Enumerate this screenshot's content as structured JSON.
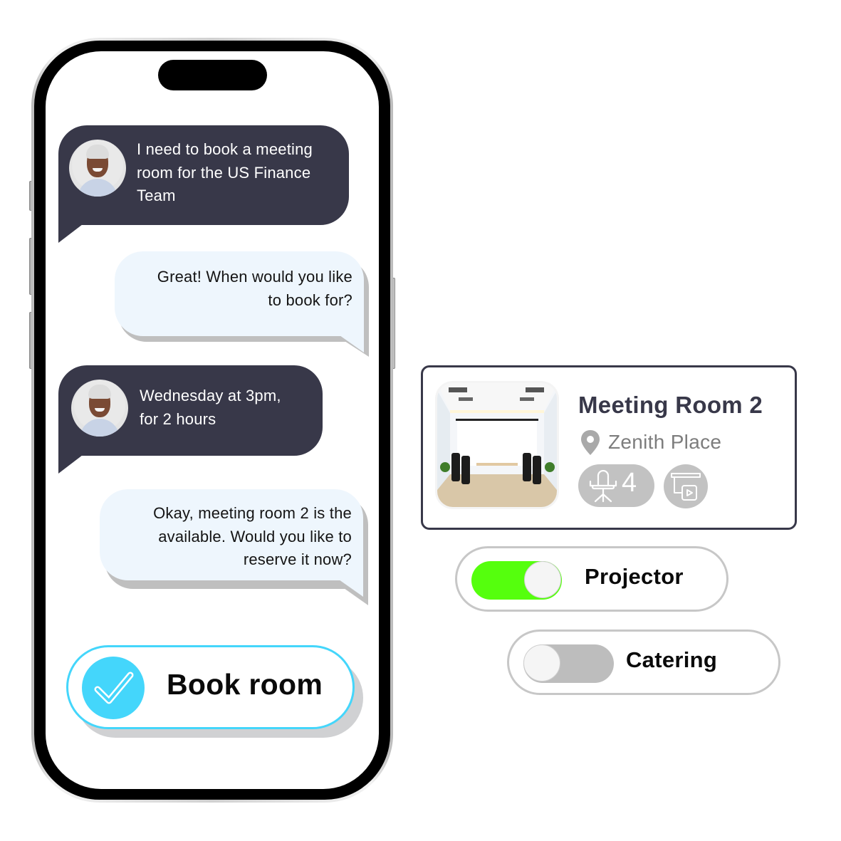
{
  "chat": {
    "messages": [
      {
        "sender": "user",
        "text_lines": [
          "I need to book a meeting",
          "room for the US Finance",
          "Team"
        ],
        "avatar": "user-avatar"
      },
      {
        "sender": "assistant",
        "text_lines": [
          "Great! When would you like",
          "to book for?"
        ]
      },
      {
        "sender": "user",
        "text_lines": [
          "Wednesday at 3pm,",
          "for 2 hours"
        ],
        "avatar": "user-avatar"
      },
      {
        "sender": "assistant",
        "text_lines": [
          "Okay, meeting room 2 is the",
          "available. Would you like to",
          "reserve it now?"
        ]
      }
    ]
  },
  "book_button": {
    "label": "Book room",
    "icon": "checkmark-icon"
  },
  "room_card": {
    "title": "Meeting Room 2",
    "location": "Zenith Place",
    "location_icon": "map-pin-icon",
    "capacity": "4",
    "capacity_icon": "office-chair-icon",
    "amenity_icon": "projector-screen-icon"
  },
  "toggles": [
    {
      "label": "Projector",
      "on": true
    },
    {
      "label": "Catering",
      "on": false
    }
  ],
  "colors": {
    "user_bubble": "#383849",
    "assistant_bubble": "#eef6fd",
    "accent_cyan": "#44d6fb",
    "toggle_on": "#55ff0d",
    "toggle_off": "#bdbdbd",
    "icon_gray": "#c2c2c2"
  }
}
